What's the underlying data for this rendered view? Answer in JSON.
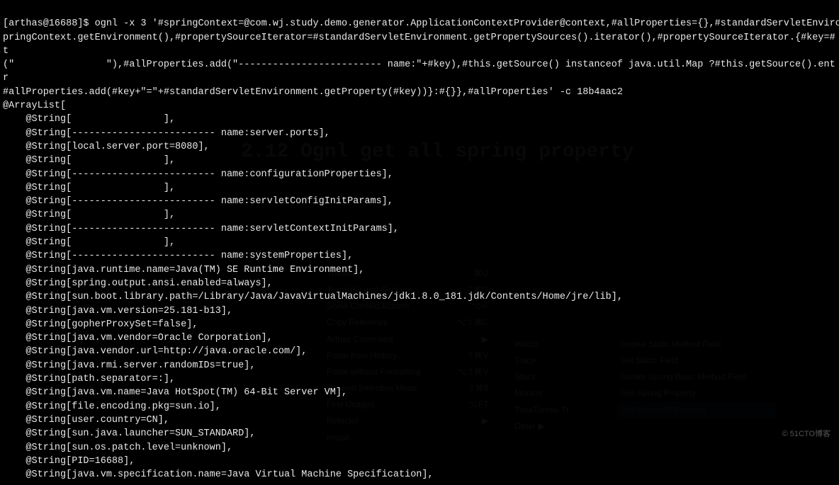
{
  "prompt": "[arthas@16688]$ ",
  "command": "ognl -x 3 '#springContext=@com.wj.study.demo.generator.ApplicationContextProvider@context,#allProperties={},#standardServletEnviro",
  "command_cont1": "pringContext.getEnvironment(),#propertySourceIterator=#standardServletEnvironment.getPropertySources().iterator(),#propertySourceIterator.{#key=#t",
  "command_cont2": "(\"                \"),#allProperties.add(\"------------------------- name:\"+#key),#this.getSource() instanceof java.util.Map ?#this.getSource().entr",
  "command_cont3": "#allProperties.add(#key+\"=\"+#standardServletEnvironment.getProperty(#key))}:#{}},#allProperties' -c 18b4aac2",
  "output_header": "@ArrayList[",
  "lines": [
    "    @String[                ],",
    "    @String[------------------------- name:server.ports],",
    "    @String[local.server.port=8080],",
    "    @String[                ],",
    "    @String[------------------------- name:configurationProperties],",
    "    @String[                ],",
    "    @String[------------------------- name:servletConfigInitParams],",
    "    @String[                ],",
    "    @String[------------------------- name:servletContextInitParams],",
    "    @String[                ],",
    "    @String[------------------------- name:systemProperties],",
    "    @String[java.runtime.name=Java(TM) SE Runtime Environment],",
    "    @String[spring.output.ansi.enabled=always],",
    "    @String[sun.boot.library.path=/Library/Java/JavaVirtualMachines/jdk1.8.0_181.jdk/Contents/Home/jre/lib],",
    "    @String[java.vm.version=25.181-b13],",
    "    @String[gopherProxySet=false],",
    "    @String[java.vm.vendor=Oracle Corporation],",
    "    @String[java.vendor.url=http://java.oracle.com/],",
    "    @String[java.rmi.server.randomIDs=true],",
    "    @String[path.separator=:],",
    "    @String[java.vm.name=Java HotSpot(TM) 64-Bit Server VM],",
    "    @String[file.encoding.pkg=sun.io],",
    "    @String[user.country=CN],",
    "    @String[sun.java.launcher=SUN_STANDARD],",
    "    @String[sun.os.patch.level=unknown],",
    "    @String[PID=16688],",
    "    @String[java.vm.specification.name=Java Virtual Machine Specification],"
  ],
  "bg": {
    "heading": "2.12 Ognl get all spring property",
    "menu": [
      {
        "l": "Translate",
        "r": "⌘U"
      },
      {
        "l": "Translate and Replace...",
        "r": "⌃⌘O"
      },
      {
        "l": "Show Context Actions",
        "r": "⌥⏎"
      },
      {
        "l": "Copy Reference",
        "r": "⌥⇧⌘C"
      },
      {
        "l": "Arthas Command",
        "r": "▶"
      },
      {
        "l": "Paste from History...",
        "r": "⇧⌘V"
      },
      {
        "l": "Paste without Formatting",
        "r": "⌥⇧⌘V"
      },
      {
        "l": "Column Selection Mode",
        "r": "⇧⌘8"
      },
      {
        "l": "Find Usages",
        "r": "⌥F7"
      },
      {
        "l": "Refactor",
        "r": "▶"
      },
      {
        "l": "Install",
        "r": ""
      }
    ],
    "submenu": [
      "Watch",
      "Trace",
      "Stack",
      "Monitor",
      "TimeTunnel Tt",
      "Other ▶"
    ],
    "submenu2": [
      {
        "t": "Invoke Static Method Field",
        "hl": false
      },
      {
        "t": "Set Static Field",
        "hl": false
      },
      {
        "t": "Invoke Spring Bean Method Field",
        "hl": false
      },
      {
        "t": "Get Spring Property",
        "hl": false
      },
      {
        "t": "Get Select All Property",
        "hl": true
      }
    ]
  },
  "watermark": "© 51CTO博客"
}
